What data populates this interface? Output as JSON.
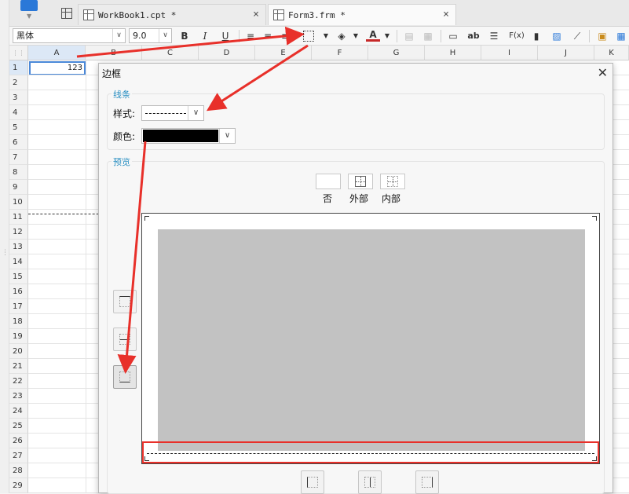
{
  "tabs": [
    {
      "label": "WorkBook1.cpt *",
      "close": "×"
    },
    {
      "label": "Form3.frm *",
      "close": "×"
    }
  ],
  "toolbar": {
    "font_name": "黑体",
    "font_size": "9.0",
    "bold": "B",
    "italic": "I",
    "underline": "U",
    "text_ab": "ab",
    "formula": "F(x)",
    "dropdown_arrow": "▼"
  },
  "sheet": {
    "corner_glyph": "⋮⋮",
    "columns": [
      "A",
      "B",
      "C",
      "D",
      "E",
      "F",
      "G",
      "H",
      "I",
      "J",
      "K"
    ],
    "rows": [
      "1",
      "2",
      "3",
      "4",
      "5",
      "6",
      "7",
      "8",
      "9",
      "10",
      "11",
      "12",
      "13",
      "14",
      "15",
      "16",
      "17",
      "18",
      "19",
      "20",
      "21",
      "22",
      "23",
      "24",
      "25",
      "26",
      "27",
      "28",
      "29"
    ],
    "cell_a1": "123"
  },
  "dialog": {
    "title": "边框",
    "close": "✕",
    "line_group": "线条",
    "style_label": "样式:",
    "color_label": "颜色:",
    "color_value": "#000000",
    "select_arrow": "∨",
    "preview_group": "预览",
    "presets": [
      "否",
      "外部",
      "内部"
    ]
  },
  "colors": {
    "accent": "#2a8fc2",
    "highlight": "#e8302a",
    "selection": "#4a88d8"
  }
}
